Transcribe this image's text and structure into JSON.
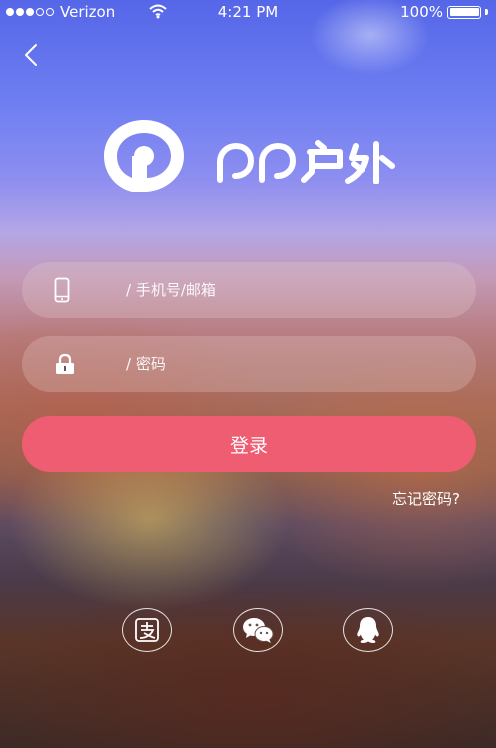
{
  "status_bar": {
    "carrier": "Verizon",
    "time": "4:21 PM",
    "battery": "100%",
    "signal_bars_filled": 3,
    "signal_bars_total": 5
  },
  "nav": {
    "back_icon": "chevron-left-icon"
  },
  "brand": {
    "logo_icon": "pp-logo-icon",
    "name": "PP户外"
  },
  "form": {
    "phone_icon": "mobile-phone-icon",
    "phone_placeholder": "/ 手机号/邮箱",
    "password_icon": "lock-icon",
    "password_placeholder": "/ 密码",
    "login_label": "登录",
    "forgot_label": "忘记密码?"
  },
  "social_logins": [
    {
      "icon": "alipay-icon"
    },
    {
      "icon": "wechat-icon"
    },
    {
      "icon": "qq-icon"
    }
  ],
  "colors": {
    "login_button": "#ef5d72",
    "text": "#ffffff"
  }
}
